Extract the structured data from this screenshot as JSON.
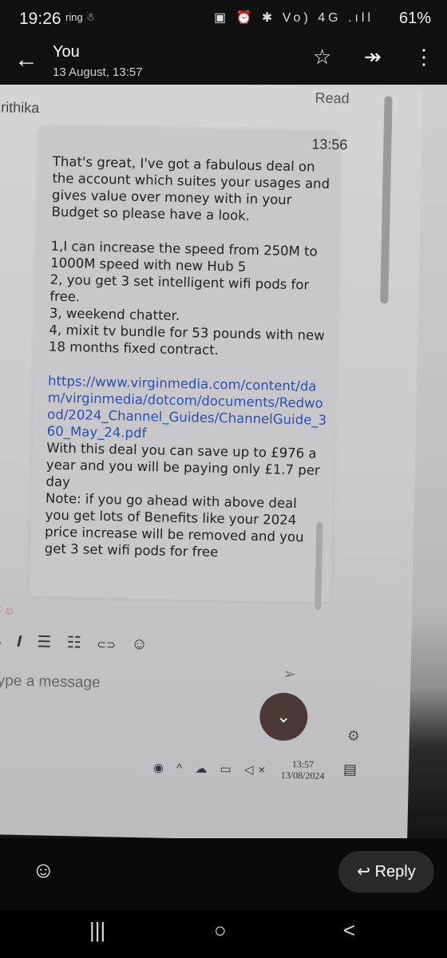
{
  "status_bar": {
    "time": "19:26",
    "left_icons": "ring ☃",
    "right_icons": "▣ ⏰ ✱ Vo) 4G .ıll",
    "battery": "61%"
  },
  "app_bar": {
    "title": "You",
    "subtitle": "13 August, 13:57",
    "back_icon": "←",
    "star_icon": "☆",
    "forward_icon": "↠",
    "more_icon": "⋮"
  },
  "chat": {
    "sender": "Krithika",
    "read_label": "Read",
    "time": "13:56",
    "message": {
      "intro": "That's great, I've got a fabulous deal on the account which suites your usages and gives value over money with in your Budget so please have a look.",
      "points": [
        "1,I can increase the speed from 250M to 1000M speed with new Hub 5",
        "2, you get 3 set intelligent wifi pods for free.",
        "3, weekend chatter.",
        "4, mixit tv bundle for 53 pounds with new 18 months fixed contract."
      ],
      "link": "https://www.virginmedia.com/content/dam/virginmedia/dotcom/documents/Redwood/2024_Channel_Guides/ChannelGuide_360_May_24.pdf",
      "savings": "With this deal you can save up to £976 a year and you will be paying only £1.7 per day",
      "note": "Note: if you go ahead with above deal you get lots of Benefits like your 2024 price increase will be removed and you get 3 set wifi pods for free"
    }
  },
  "composer": {
    "bold": "B",
    "italic": "I",
    "bullets": "☰",
    "numbers": "☷",
    "link_icon": "⊂⊃",
    "emoji_icon": "☺",
    "placeholder": "Type a message",
    "send_icon": "➢",
    "scroll_down_icon": "⌄",
    "gear_icon": "⚙"
  },
  "taskbar": {
    "icons": "◉ ^ ☁ ▭ ◁×",
    "time": "13:57",
    "date": "13/08/2024",
    "notif": "▤"
  },
  "bottom_actions": {
    "emoji_icon": "☺",
    "reply_label": "Reply",
    "reply_icon": "↩"
  },
  "nav_bar": {
    "recents": "|||",
    "home": "○",
    "back": "<"
  }
}
